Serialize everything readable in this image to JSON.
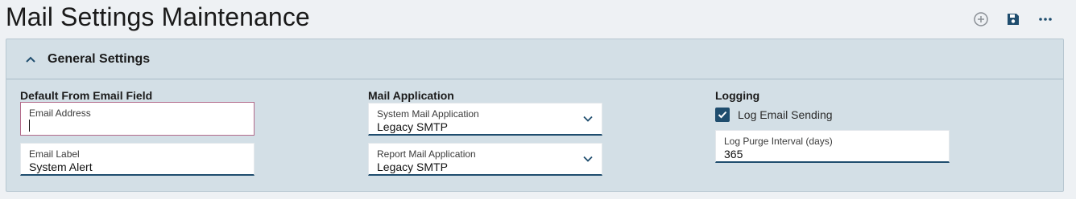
{
  "page": {
    "title": "Mail Settings Maintenance"
  },
  "toolbar": {
    "add_icon": "plus-circle-icon",
    "save_icon": "floppy-disk-icon",
    "more_icon": "ellipsis-icon"
  },
  "panel": {
    "title": "General Settings",
    "collapse_icon": "chevron-up-icon"
  },
  "default_from": {
    "section_title": "Default From Email Field",
    "email_address": {
      "label": "Email Address",
      "value": ""
    },
    "email_label": {
      "label": "Email Label",
      "value": "System Alert"
    }
  },
  "mail_application": {
    "section_title": "Mail Application",
    "system_mail": {
      "label": "System Mail Application",
      "value": "Legacy SMTP"
    },
    "report_mail": {
      "label": "Report Mail Application",
      "value": "Legacy SMTP"
    }
  },
  "logging": {
    "section_title": "Logging",
    "log_email_sending": {
      "label": "Log Email Sending",
      "checked": true
    },
    "purge_interval": {
      "label": "Log Purge Interval (days)",
      "value": "365"
    }
  },
  "colors": {
    "accent": "#1f4d6e",
    "panel_bg": "#d3dfe6",
    "page_bg": "#eef1f4",
    "focus_border": "#b26a8a"
  }
}
